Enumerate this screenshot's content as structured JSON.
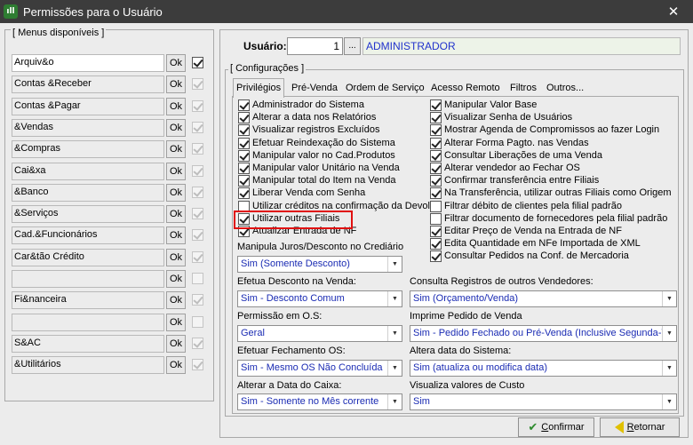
{
  "window": {
    "title": "Permissões para o Usuário",
    "icon": "app-icon",
    "icon_text": "ıll",
    "close_label": "✕"
  },
  "menus": {
    "label": "[ Menus disponíveis ]",
    "ok_label": "Ok",
    "items": [
      {
        "label": "Arquiv&o",
        "checked": true,
        "enabled": true
      },
      {
        "label": "Contas &Receber",
        "checked": true,
        "enabled": false
      },
      {
        "label": "Contas &Pagar",
        "checked": true,
        "enabled": false
      },
      {
        "label": "&Vendas",
        "checked": true,
        "enabled": false
      },
      {
        "label": "&Compras",
        "checked": true,
        "enabled": false
      },
      {
        "label": "Cai&xa",
        "checked": true,
        "enabled": false
      },
      {
        "label": "&Banco",
        "checked": true,
        "enabled": false
      },
      {
        "label": "&Serviços",
        "checked": true,
        "enabled": false
      },
      {
        "label": "Cad.&Funcionários",
        "checked": true,
        "enabled": false
      },
      {
        "label": "Car&tão Crédito",
        "checked": true,
        "enabled": false
      },
      {
        "label": "",
        "checked": false,
        "enabled": false
      },
      {
        "label": "Fi&nanceira",
        "checked": true,
        "enabled": false
      },
      {
        "label": "",
        "checked": false,
        "enabled": false
      },
      {
        "label": "S&AC",
        "checked": true,
        "enabled": false
      },
      {
        "label": "&Utilitários",
        "checked": true,
        "enabled": false
      }
    ]
  },
  "usuario": {
    "label": "Usuário:",
    "id": "1",
    "lookup_label": "...",
    "name": "ADMINISTRADOR"
  },
  "config": {
    "label": "[ Configurações ]",
    "tabs": [
      "Privilégios",
      "Pré-Venda",
      "Ordem de Serviço",
      "Acesso Remoto",
      "Filtros",
      "Outros..."
    ],
    "left_perms": [
      {
        "label": "Administrador do Sistema",
        "checked": true
      },
      {
        "label": "Alterar a data nos Relatórios",
        "checked": true
      },
      {
        "label": "Visualizar registros Excluídos",
        "checked": true
      },
      {
        "label": "Efetuar Reindexação do Sistema",
        "checked": true
      },
      {
        "label": "Manipular valor no Cad.Produtos",
        "checked": true
      },
      {
        "label": "Manipular valor Unitário na Venda",
        "checked": true
      },
      {
        "label": "Manipular total do Item na Venda",
        "checked": true
      },
      {
        "label": "Liberar Venda com Senha",
        "checked": true
      },
      {
        "label": "Utilizar créditos na confirmação da Devol.",
        "checked": false
      },
      {
        "label": "Utilizar outras Filiais",
        "checked": true
      },
      {
        "label": "Atualizar Entrada de NF",
        "checked": true
      }
    ],
    "right_perms": [
      {
        "label": "Manipular Valor Base",
        "checked": true
      },
      {
        "label": "Visualizar Senha de Usuários",
        "checked": true
      },
      {
        "label": "Mostrar Agenda de Compromissos ao fazer Login",
        "checked": true
      },
      {
        "label": "Alterar Forma Pagto. nas Vendas",
        "checked": true
      },
      {
        "label": "Consultar Liberações de uma Venda",
        "checked": true
      },
      {
        "label": "Alterar vendedor ao Fechar OS",
        "checked": true
      },
      {
        "label": "Confirmar transferência entre Filiais",
        "checked": true
      },
      {
        "label": "Na Transferência, utilizar outras Filiais como Origem",
        "checked": true
      },
      {
        "label": "Filtrar débito de clientes pela filial padrão",
        "checked": false
      },
      {
        "label": "Filtrar documento de fornecedores pela filial padrão",
        "checked": false
      },
      {
        "label": "Editar Preço de Venda na Entrada de NF",
        "checked": true
      },
      {
        "label": "Edita Quantidade em NFe Importada de XML",
        "checked": true
      },
      {
        "label": "Consultar Pedidos na Conf. de Mercadoria",
        "checked": true
      }
    ],
    "fields": {
      "juros": {
        "label": "Manipula Juros/Desconto no Crediário",
        "value": "Sim (Somente Desconto)"
      },
      "desconto": {
        "label": "Efetua Desconto na Venda:",
        "value": "Sim - Desconto Comum"
      },
      "consulta": {
        "label": "Consulta Registros de outros Vendedores:",
        "value": "Sim (Orçamento/Venda)"
      },
      "permissao": {
        "label": "Permissão em O.S:",
        "value": "Geral"
      },
      "imprime": {
        "label": "Imprime Pedido de Venda",
        "value": "Sim - Pedido Fechado ou Pré-Venda (Inclusive Segunda-Via)"
      },
      "fechamento": {
        "label": "Efetuar Fechamento OS:",
        "value": "Sim - Mesmo OS Não Concluída"
      },
      "altera_data": {
        "label": "Altera data do Sistema:",
        "value": "Sim (atualiza ou modifica data)"
      },
      "data_caixa": {
        "label": "Alterar a Data do Caixa:",
        "value": "Sim - Somente no Mês corrente"
      },
      "custo": {
        "label": "Visualiza valores de Custo",
        "value": "Sim"
      }
    }
  },
  "buttons": {
    "confirmar_first": "C",
    "confirmar_rest": "onfirmar",
    "retornar_first": "R",
    "retornar_rest": "etornar"
  },
  "colors": {
    "titlebar": "#3c3c3c",
    "combo_text": "#1a2bb3",
    "highlight": "#e01010",
    "user_name_text": "#2233cc"
  }
}
